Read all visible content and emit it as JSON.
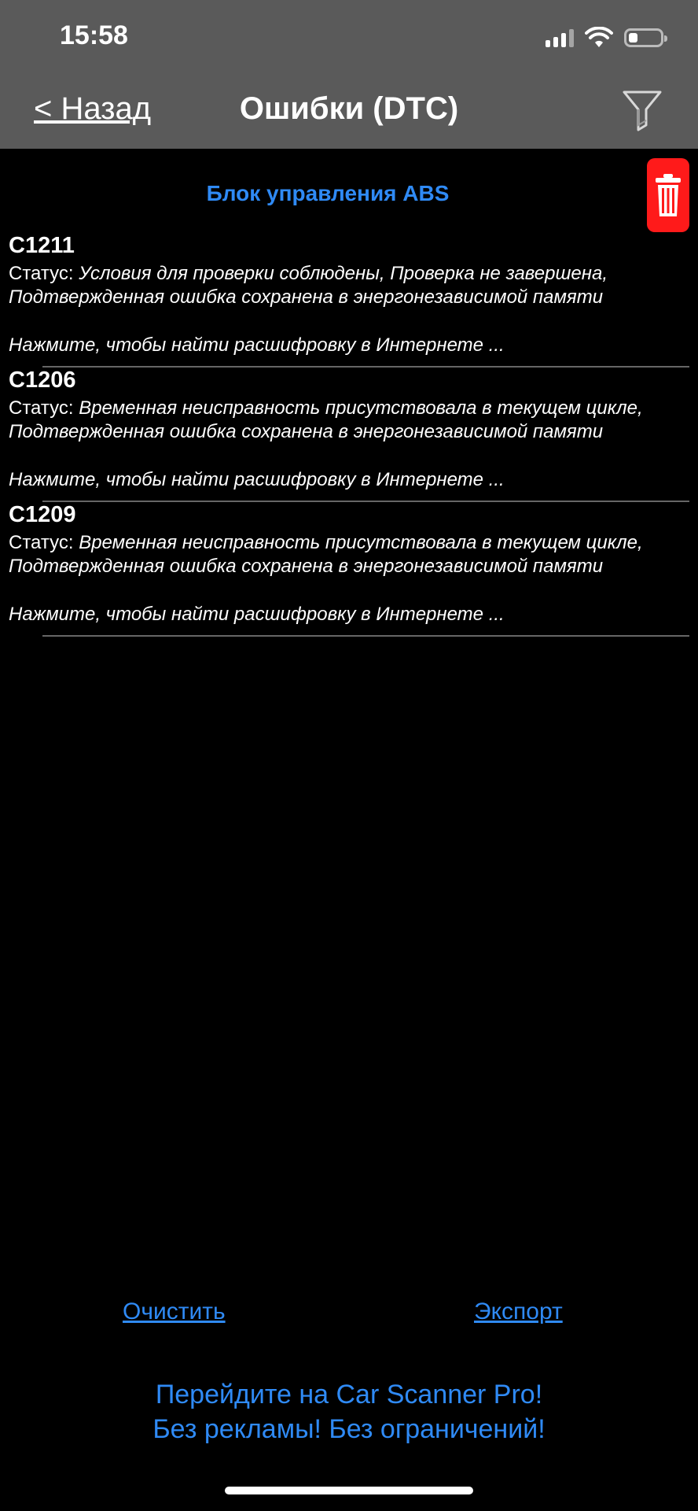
{
  "status_bar": {
    "time": "15:58",
    "icons": [
      "signal-icon",
      "wifi-icon",
      "battery-icon"
    ],
    "battery_level": 0.3
  },
  "nav": {
    "back_label": "< Назад",
    "title": "Ошибки (DTC)",
    "filter_icon": "filter-icon"
  },
  "delete_icon": "trash-icon",
  "section": {
    "title": "Блок управления ABS"
  },
  "status_label": "Статус: ",
  "dtc_items": [
    {
      "code": "C1211",
      "status": "Условия для проверки соблюдены, Проверка не завершена, Подтвержденная ошибка сохранена в энергонезависимой памяти",
      "hint": "Нажмите, чтобы найти расшифровку в Интернете ..."
    },
    {
      "code": "C1206",
      "status": "Временная неисправность присутствовала в текущем цикле, Подтвержденная ошибка сохранена в энергонезависимой памяти",
      "hint": "Нажмите, чтобы найти расшифровку в Интернете ..."
    },
    {
      "code": "C1209",
      "status": "Временная неисправность присутствовала в текущем цикле, Подтвержденная ошибка сохранена в энергонезависимой памяти",
      "hint": "Нажмите, чтобы найти расшифровку в Интернете ..."
    }
  ],
  "actions": {
    "clear_label": "Очистить",
    "export_label": "Экспорт"
  },
  "promo": {
    "line1": "Перейдите на Car Scanner Pro!",
    "line2": "Без рекламы! Без ограничений!"
  },
  "colors": {
    "accent": "#2f8af5",
    "delete": "#ff1a1a",
    "header_bg": "#5a5a5a"
  }
}
